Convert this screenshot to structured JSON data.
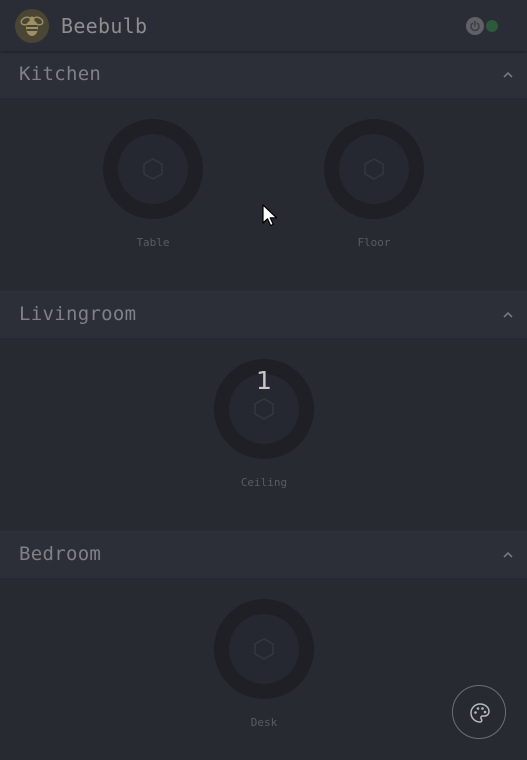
{
  "app": {
    "title": "Beebulb",
    "logo_icon": "bee-icon",
    "power_icon": "power-icon",
    "status_color": "#2c5a3a"
  },
  "rooms": [
    {
      "name": "Kitchen",
      "lights": [
        {
          "label": "Table",
          "icon": "hexagon-icon"
        },
        {
          "label": "Floor",
          "icon": "hexagon-icon"
        }
      ]
    },
    {
      "name": "Livingroom",
      "lights": [
        {
          "label": "Ceiling",
          "icon": "hexagon-icon",
          "count": "1"
        }
      ]
    },
    {
      "name": "Bedroom",
      "lights": [
        {
          "label": "Desk",
          "icon": "hexagon-icon"
        }
      ]
    }
  ],
  "fab": {
    "icon": "palette-icon"
  },
  "colors": {
    "background": "#272a31",
    "header": "#2c2f37",
    "ring": "#1e2026",
    "logo": "#4a4534"
  }
}
